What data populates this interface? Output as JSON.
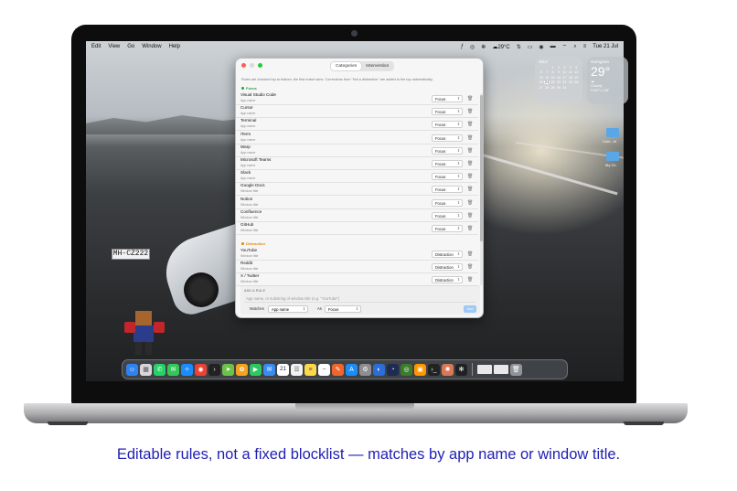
{
  "menubar": {
    "items": [
      "Edit",
      "View",
      "Go",
      "Window",
      "Help"
    ],
    "weather": "29°C",
    "clock": "Tue 21 Jul"
  },
  "widgets": {
    "calendar_month": "JULY",
    "calendar_days": [
      "1",
      "2",
      "3",
      "4",
      "5",
      "6",
      "7",
      "8",
      "9",
      "10",
      "11",
      "12",
      "13",
      "14",
      "15",
      "16",
      "17",
      "18",
      "19",
      "20",
      "21",
      "22",
      "23",
      "24",
      "25",
      "26",
      "27",
      "28",
      "29",
      "30",
      "31"
    ],
    "today": "21",
    "weather_city": "Gurugram",
    "weather_temp": "29°",
    "weather_condition": "Cloudy",
    "weather_range": "H:30° L:28°",
    "folder_1": "Com...hi",
    "folder_2": "My Ch"
  },
  "window": {
    "tabs": [
      "Categories",
      "Intervention"
    ],
    "active_tab": "Categories",
    "hint": "Rules are checked top to bottom; the first match wins. Corrections from \"Not a distraction\" are added to the top automatically.",
    "focus_section": "Focus",
    "distraction_section": "Distraction",
    "focus_rules": [
      {
        "name": "Visual Studio Code",
        "kind": "App name",
        "category": "Focus"
      },
      {
        "name": "Cursor",
        "kind": "App name",
        "category": "Focus"
      },
      {
        "name": "Terminal",
        "kind": "App name",
        "category": "Focus"
      },
      {
        "name": "iTerm",
        "kind": "App name",
        "category": "Focus"
      },
      {
        "name": "Warp",
        "kind": "App name",
        "category": "Focus"
      },
      {
        "name": "Microsoft Teams",
        "kind": "App name",
        "category": "Focus"
      },
      {
        "name": "Slack",
        "kind": "App name",
        "category": "Focus"
      },
      {
        "name": "Google Docs",
        "kind": "Window title",
        "category": "Focus"
      },
      {
        "name": "Notion",
        "kind": "Window title",
        "category": "Focus"
      },
      {
        "name": "Confluence",
        "kind": "Window title",
        "category": "Focus"
      },
      {
        "name": "GitHub",
        "kind": "Window title",
        "category": "Focus"
      }
    ],
    "distraction_rules": [
      {
        "name": "YouTube",
        "kind": "Window title",
        "category": "Distraction"
      },
      {
        "name": "Reddit",
        "kind": "Window title",
        "category": "Distraction"
      },
      {
        "name": "X / Twitter",
        "kind": "Window title",
        "category": "Distraction"
      }
    ],
    "add_rule": {
      "label": "ADD A RULE",
      "placeholder": "App name, or substring of window title (e.g. \"YouTube\")",
      "matches_label": "Matches",
      "matches_value": "App name",
      "as_label": "As",
      "as_value": "Focus",
      "button": "Add"
    }
  },
  "dock": {
    "apps": [
      {
        "icon": "finder-icon",
        "color": "#2f83f0"
      },
      {
        "icon": "launchpad-icon",
        "color": "#d8d8dc"
      },
      {
        "icon": "whatsapp-icon",
        "color": "#25d366"
      },
      {
        "icon": "messages-icon",
        "color": "#34c759"
      },
      {
        "icon": "safari-icon",
        "color": "#1a8cff"
      },
      {
        "icon": "chrome-icon",
        "color": "#ea4335"
      },
      {
        "icon": "terminal-icon",
        "color": "#222222"
      },
      {
        "icon": "maps-icon",
        "color": "#6cc24a"
      },
      {
        "icon": "photos-icon",
        "color": "#f6a21c"
      },
      {
        "icon": "facetime-icon",
        "color": "#2bc95f"
      },
      {
        "icon": "mail-icon",
        "color": "#3b8cf2"
      },
      {
        "icon": "calendar-icon",
        "color": "#ffffff"
      },
      {
        "icon": "reminders-icon",
        "color": "#f2f2f2"
      },
      {
        "icon": "notes-icon",
        "color": "#ffd84a"
      },
      {
        "icon": "freeform-icon",
        "color": "#ffffff"
      },
      {
        "icon": "pages-icon",
        "color": "#f0652b"
      },
      {
        "icon": "app-store-icon",
        "color": "#1d8cf8"
      },
      {
        "icon": "settings-icon",
        "color": "#8e8e93"
      },
      {
        "icon": "preview-icon",
        "color": "#2a6ed6"
      },
      {
        "icon": "screen-time-icon",
        "color": "#1e2b52"
      },
      {
        "icon": "sonic-icon",
        "color": "#3a7d2a"
      },
      {
        "icon": "books-icon",
        "color": "#ff9500"
      },
      {
        "icon": "console-icon",
        "color": "#222222"
      },
      {
        "icon": "claude-icon",
        "color": "#d97757"
      },
      {
        "icon": "chatgpt-icon",
        "color": "#202123"
      }
    ],
    "calendar_day": "21"
  },
  "caption": "Editable rules, not a fixed blocklist — matches by app name or window title."
}
